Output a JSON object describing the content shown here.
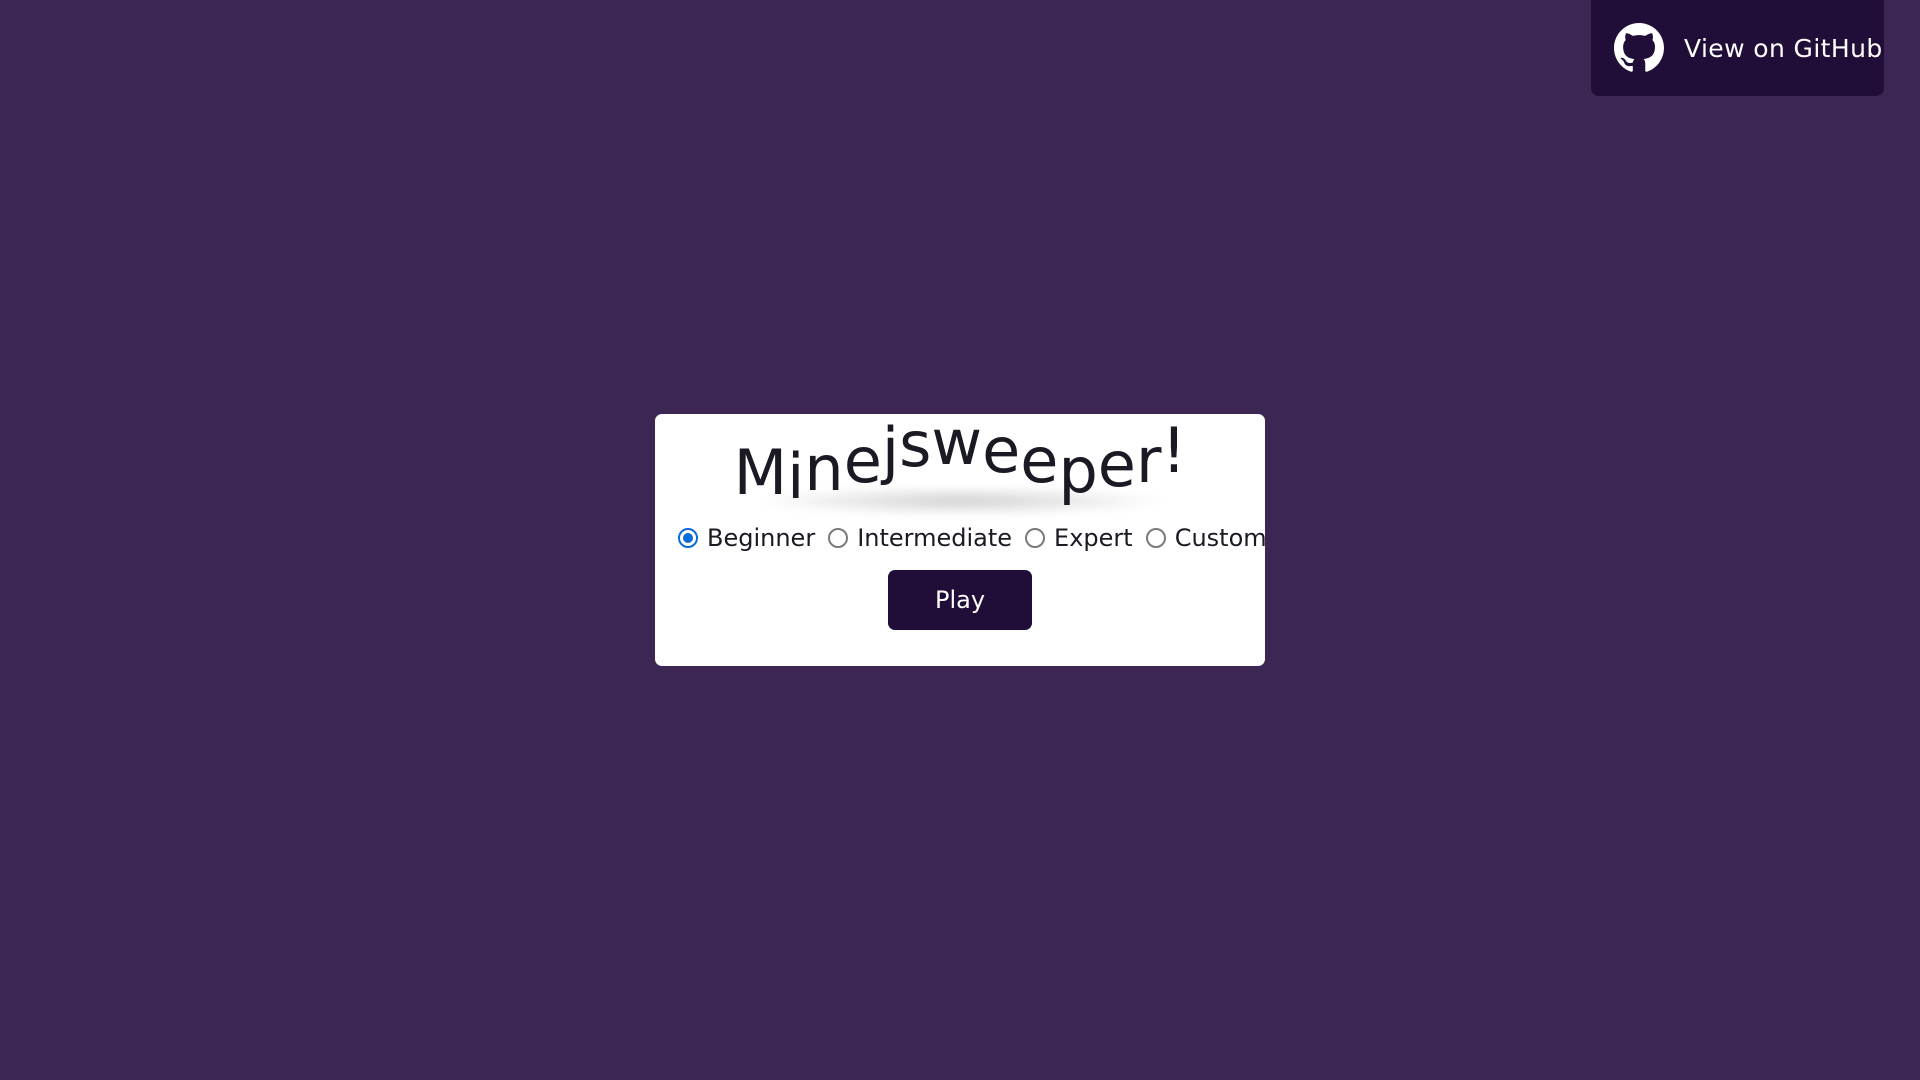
{
  "page": {
    "background_color": "#3b2654"
  },
  "github_badge": {
    "label": "View on GitHub",
    "icon": "github-icon",
    "background_color": "#200e38"
  },
  "card": {
    "title": "Minejsweeper!",
    "title_letters": [
      "M",
      "i",
      "n",
      "e",
      "j",
      "s",
      "w",
      "e",
      "e",
      "p",
      "e",
      "r",
      "!"
    ],
    "difficulty_options": [
      {
        "label": "Beginner",
        "checked": true
      },
      {
        "label": "Intermediate",
        "checked": false
      },
      {
        "label": "Expert",
        "checked": false
      },
      {
        "label": "Custom",
        "checked": false
      }
    ],
    "play_label": "Play",
    "accent_color": "#0b6bd8"
  }
}
